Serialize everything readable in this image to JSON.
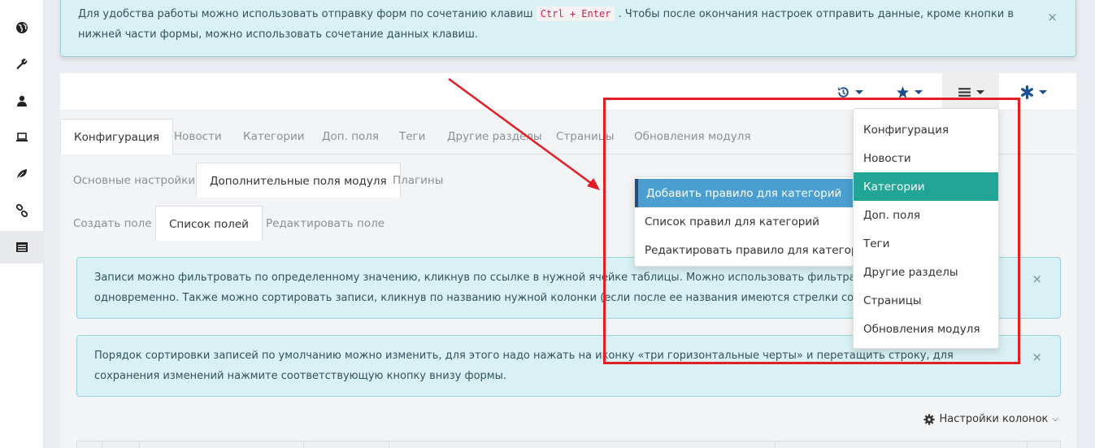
{
  "sidebar": {
    "items": [
      {
        "icon": "globe-icon"
      },
      {
        "icon": "wrench-icon"
      },
      {
        "icon": "user-icon"
      },
      {
        "icon": "laptop-icon"
      },
      {
        "icon": "leaf-icon"
      },
      {
        "icon": "link-icon"
      },
      {
        "icon": "list-icon",
        "active": true
      }
    ]
  },
  "top_alert": {
    "text_before": "Для удобства работы можно использовать отправку форм по сочетанию клавиш",
    "shortcut": "Ctrl + Enter",
    "text_after": ". Чтобы после окончания настроек отправить данные, кроме кнопки в нижней части формы, можно использовать сочетание данных клавиш.",
    "close": "×"
  },
  "toolbar": {
    "buttons": [
      {
        "icon": "history-icon"
      },
      {
        "icon": "star-icon"
      },
      {
        "icon": "menu-icon",
        "active": true
      },
      {
        "icon": "asterisk-icon"
      }
    ]
  },
  "tabs_main": [
    "Конфигурация",
    "Новости",
    "Категории",
    "Доп. поля",
    "Теги",
    "Другие разделы",
    "Страницы",
    "Обновления модуля"
  ],
  "tabs_sub": [
    "Основные настройки",
    "Дополнительные поля модуля",
    "Плагины"
  ],
  "tabs_sub2": [
    "Создать поле",
    "Список полей",
    "Редактировать поле"
  ],
  "info_alert_1": {
    "text": "Записи можно фильтровать по определенному значению, кликнув по ссылке в нужной ячейке таблицы. Можно использовать фильтрацию по нес... одновременно. Также можно сортировать записи, кликнув по названию нужной колонки (если после ее названия имеются стрелки сортировки).",
    "close": "×"
  },
  "info_alert_2": {
    "text": "Порядок сортировки записей по умолчанию можно изменить, для этого надо нажать на иконку «три горизонтальные черты» и перетащить строку, для сохранения изменений нажмите соответствующую кнопку внизу формы.",
    "close": "×"
  },
  "column_settings_label": "Настройки колонок",
  "main_menu": {
    "items": [
      "Конфигурация",
      "Новости",
      "Категории",
      "Доп. поля",
      "Теги",
      "Другие разделы",
      "Страницы",
      "Обновления модуля"
    ],
    "selected": "Категории"
  },
  "sub_menu": {
    "items": [
      "Добавить правило для категорий",
      "Список правил для категорий",
      "Редактировать правило для категорий"
    ],
    "selected": "Добавить правило для категорий"
  },
  "colors": {
    "accent_teal": "#22a597",
    "accent_blue": "#4a9fd0",
    "annotation_red": "#e31e25"
  }
}
